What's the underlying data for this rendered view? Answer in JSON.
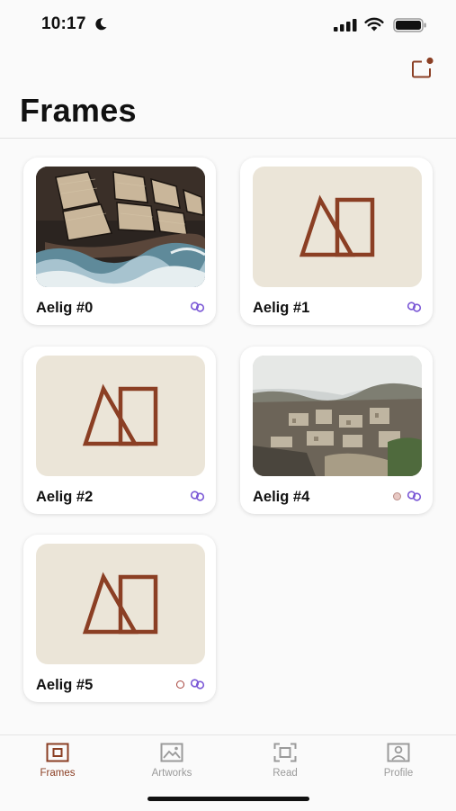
{
  "status_bar": {
    "time": "10:17",
    "icons": [
      "moon-icon",
      "signal-icon",
      "wifi-icon",
      "battery-icon"
    ]
  },
  "header": {
    "title": "Frames",
    "action_icon": "notification-frame-icon"
  },
  "colors": {
    "accent": "#8b3f24",
    "link": "#7b58d6",
    "placeholder_bg": "#ebe5d8",
    "inactive_tab": "#9a9a9a"
  },
  "frames": [
    {
      "name": "Aelig #0",
      "thumbnail": "ship-painting",
      "status_dot": false
    },
    {
      "name": "Aelig #1",
      "thumbnail": "placeholder-logo",
      "status_dot": false
    },
    {
      "name": "Aelig #2",
      "thumbnail": "placeholder-logo",
      "status_dot": false
    },
    {
      "name": "Aelig #4",
      "thumbnail": "city-photo",
      "status_dot": true,
      "status_dot_style": "filled-pink"
    },
    {
      "name": "Aelig #5",
      "thumbnail": "placeholder-logo",
      "status_dot": true,
      "status_dot_style": "outline-red"
    }
  ],
  "tabs": [
    {
      "label": "Frames",
      "icon": "frame-icon",
      "active": true
    },
    {
      "label": "Artworks",
      "icon": "image-icon",
      "active": false
    },
    {
      "label": "Read",
      "icon": "scan-icon",
      "active": false
    },
    {
      "label": "Profile",
      "icon": "profile-icon",
      "active": false
    }
  ]
}
